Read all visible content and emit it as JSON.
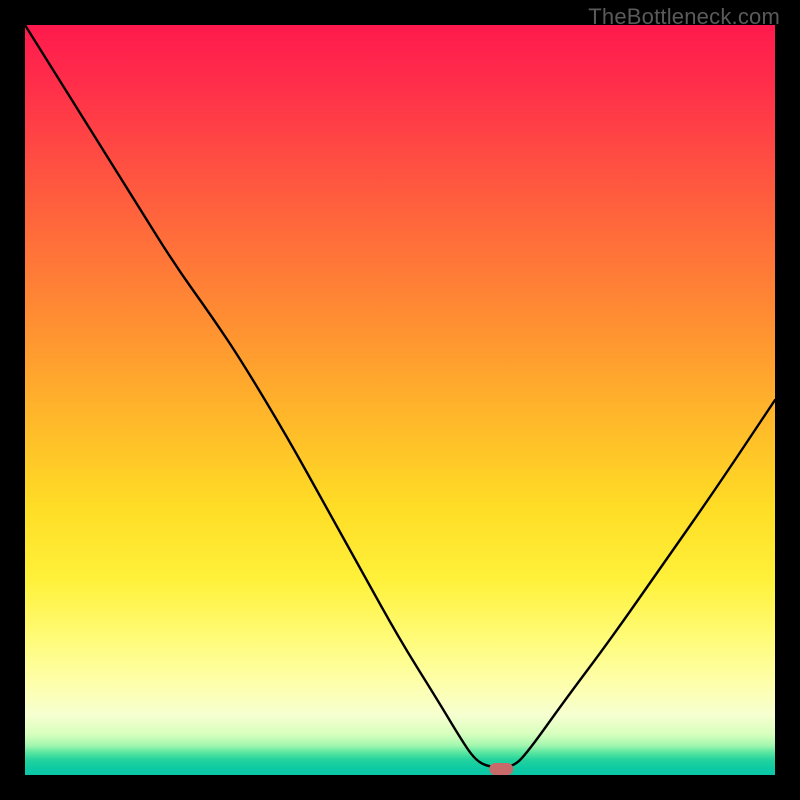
{
  "watermark": "TheBottleneck.com",
  "colors": {
    "curve": "#000000",
    "marker": "#c76a6a",
    "gradient_top": "#ff1a4d",
    "gradient_bottom": "#0bc6a6",
    "frame": "#000000"
  },
  "chart_data": {
    "type": "line",
    "title": "",
    "xlabel": "",
    "ylabel": "",
    "xlim": [
      0,
      100
    ],
    "ylim": [
      0,
      100
    ],
    "grid": false,
    "legend": false,
    "annotation": "Background gradient from red (top, high bottleneck) through orange/yellow to green (bottom, low bottleneck).",
    "series": [
      {
        "name": "bottleneck-curve",
        "x": [
          0,
          5,
          10,
          15,
          20,
          25,
          29,
          35,
          40,
          45,
          50,
          55,
          58,
          60,
          62,
          65,
          67,
          72,
          78,
          85,
          92,
          100
        ],
        "values": [
          100,
          92,
          84,
          76,
          68,
          61,
          55,
          45,
          36,
          27,
          18,
          10,
          5,
          2,
          1,
          1,
          3,
          10,
          18,
          28,
          38,
          50
        ]
      }
    ],
    "marker": {
      "x": 63.5,
      "y": 0.8,
      "shape": "rounded-rect"
    }
  }
}
